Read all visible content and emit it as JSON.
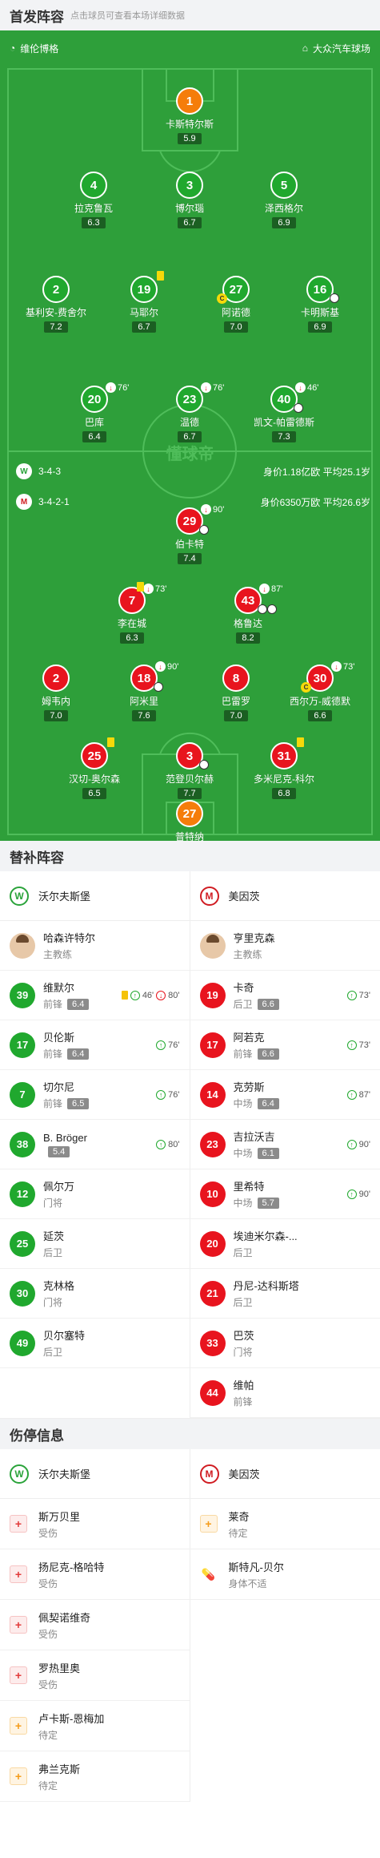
{
  "header": {
    "title": "首发阵容",
    "subtitle": "点击球员可查看本场详细数据"
  },
  "pitch": {
    "home_stadium_team": "维伦博格",
    "away_stadium_team": "大众汽车球场",
    "watermark": "懂球帝",
    "home_formation": {
      "formation": "3-4-3",
      "value_info": "身价1.18亿欧  平均25.1岁"
    },
    "away_formation": {
      "formation": "3-4-2-1",
      "value_info": "身价6350万欧  平均26.6岁"
    },
    "players": [
      {
        "num": "1",
        "name": "卡斯特尔斯",
        "rating": "5.9",
        "color": "orange"
      },
      {
        "num": "4",
        "name": "拉克鲁瓦",
        "rating": "6.3",
        "color": "green"
      },
      {
        "num": "3",
        "name": "博尔瑙",
        "rating": "6.7",
        "color": "green"
      },
      {
        "num": "5",
        "name": "泽西格尔",
        "rating": "6.9",
        "color": "green"
      },
      {
        "num": "2",
        "name": "基利安-费舍尔",
        "rating": "7.2",
        "color": "green"
      },
      {
        "num": "19",
        "name": "马耶尔",
        "rating": "6.7",
        "color": "green"
      },
      {
        "num": "27",
        "name": "阿诺德",
        "rating": "7.0",
        "color": "green"
      },
      {
        "num": "16",
        "name": "卡明斯基",
        "rating": "6.9",
        "color": "green"
      },
      {
        "num": "20",
        "name": "巴库",
        "rating": "6.4",
        "color": "green",
        "sub_min": "76'"
      },
      {
        "num": "23",
        "name": "温德",
        "rating": "6.7",
        "color": "green",
        "sub_min": "76'"
      },
      {
        "num": "40",
        "name": "凯文-帕雷德斯",
        "rating": "7.3",
        "color": "green",
        "sub_min": "46'"
      },
      {
        "num": "29",
        "name": "伯卡特",
        "rating": "7.4",
        "color": "red",
        "sub_min": "90'"
      },
      {
        "num": "7",
        "name": "李在城",
        "rating": "6.3",
        "color": "red",
        "sub_min": "73'"
      },
      {
        "num": "43",
        "name": "格鲁达",
        "rating": "8.2",
        "color": "red",
        "sub_min": "87'"
      },
      {
        "num": "2",
        "name": "姆韦内",
        "rating": "7.0",
        "color": "red"
      },
      {
        "num": "18",
        "name": "阿米里",
        "rating": "7.6",
        "color": "red",
        "sub_min": "90'"
      },
      {
        "num": "8",
        "name": "巴雷罗",
        "rating": "7.0",
        "color": "red"
      },
      {
        "num": "30",
        "name": "西尔万-威德默",
        "rating": "6.6",
        "color": "red",
        "sub_min": "73'"
      },
      {
        "num": "25",
        "name": "汉切-奥尔森",
        "rating": "6.5",
        "color": "red"
      },
      {
        "num": "3",
        "name": "范登贝尔赫",
        "rating": "7.7",
        "color": "red"
      },
      {
        "num": "31",
        "name": "多米尼克-科尔",
        "rating": "6.8",
        "color": "red"
      },
      {
        "num": "27",
        "name": "普特纳",
        "rating": "7.1",
        "color": "orange"
      }
    ]
  },
  "subs": {
    "title": "替补阵容",
    "home_team": "沃尔夫斯堡",
    "away_team": "美因茨",
    "home_coach": {
      "name": "哈森许特尔",
      "role": "主教练"
    },
    "away_coach": {
      "name": "亨里克森",
      "role": "主教练"
    },
    "home": [
      {
        "num": "39",
        "name": "维默尔",
        "pos": "前锋",
        "rating": "6.4",
        "in": "46'",
        "out": "80'",
        "yellow": true
      },
      {
        "num": "17",
        "name": "贝伦斯",
        "pos": "前锋",
        "rating": "6.4",
        "in": "76'"
      },
      {
        "num": "7",
        "name": "切尔尼",
        "pos": "前锋",
        "rating": "6.5",
        "in": "76'"
      },
      {
        "num": "38",
        "name": "B. Bröger",
        "pos": "",
        "rating": "5.4",
        "in": "80'"
      },
      {
        "num": "12",
        "name": "佩尔万",
        "pos": "门将"
      },
      {
        "num": "25",
        "name": "延茨",
        "pos": "后卫"
      },
      {
        "num": "30",
        "name": "克林格",
        "pos": "门将"
      },
      {
        "num": "49",
        "name": "贝尔塞特",
        "pos": "后卫"
      }
    ],
    "away": [
      {
        "num": "19",
        "name": "卡奇",
        "pos": "后卫",
        "rating": "6.6",
        "in": "73'"
      },
      {
        "num": "17",
        "name": "阿若克",
        "pos": "前锋",
        "rating": "6.6",
        "in": "73'"
      },
      {
        "num": "14",
        "name": "克劳斯",
        "pos": "中场",
        "rating": "6.4",
        "in": "87'"
      },
      {
        "num": "23",
        "name": "吉拉沃吉",
        "pos": "中场",
        "rating": "6.1",
        "in": "90'"
      },
      {
        "num": "10",
        "name": "里希特",
        "pos": "中场",
        "rating": "5.7",
        "in": "90'"
      },
      {
        "num": "20",
        "name": "埃迪米尔森-...",
        "pos": "后卫"
      },
      {
        "num": "21",
        "name": "丹尼-达科斯塔",
        "pos": "后卫"
      },
      {
        "num": "33",
        "name": "巴茨",
        "pos": "门将"
      },
      {
        "num": "44",
        "name": "维帕",
        "pos": "前锋"
      }
    ]
  },
  "injuries": {
    "title": "伤停信息",
    "home": [
      {
        "name": "斯万贝里",
        "status": "受伤",
        "type": "red"
      },
      {
        "name": "扬尼克-格哈特",
        "status": "受伤",
        "type": "red"
      },
      {
        "name": "佩契诺维奇",
        "status": "受伤",
        "type": "red"
      },
      {
        "name": "罗热里奥",
        "status": "受伤",
        "type": "red"
      },
      {
        "name": "卢卡斯-恩梅加",
        "status": "待定",
        "type": "orange"
      },
      {
        "name": "弗兰克斯",
        "status": "待定",
        "type": "orange"
      }
    ],
    "away": [
      {
        "name": "莱奇",
        "status": "待定",
        "type": "orange"
      },
      {
        "name": "斯特凡-贝尔",
        "status": "身体不适",
        "type": "pill"
      }
    ]
  },
  "colors": {
    "pitch": "#2e9f3a",
    "home": "#20a82e",
    "away": "#e8141e",
    "gk": "#f57d0a"
  }
}
